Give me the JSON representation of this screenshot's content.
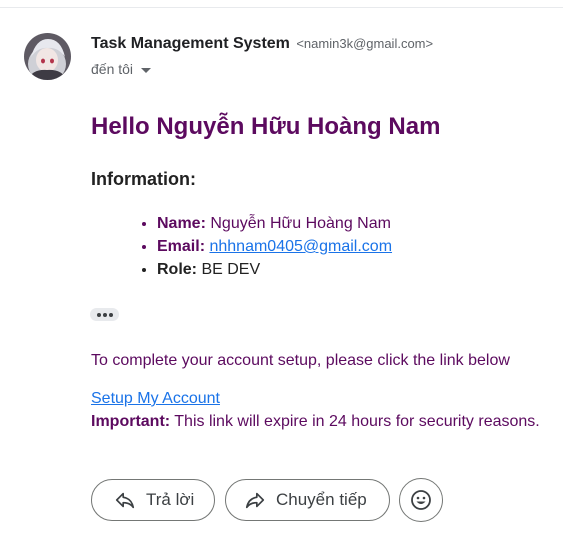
{
  "sender": {
    "name": "Task Management System",
    "email": "<namin3k@gmail.com>",
    "recipient_label": "đến tôi"
  },
  "body": {
    "greeting": "Hello Nguyễn Hữu Hoàng Nam",
    "info_heading": "Information:",
    "info_items": [
      {
        "label": "Name:",
        "value": "Nguyễn Hữu Hoàng Nam"
      },
      {
        "label": "Email:",
        "value": "nhhnam0405@gmail.com"
      },
      {
        "label": "Role:",
        "value": "BE DEV"
      }
    ],
    "complete_text": "To complete your account setup, please click the link below",
    "setup_link": "Setup My Account",
    "important_label": "Important:",
    "important_text": " This link will expire in 24 hours for security reasons."
  },
  "actions": {
    "reply_label": "Trả lời",
    "forward_label": "Chuyển tiếp"
  },
  "icons": {
    "reply": "reply-icon",
    "forward": "forward-icon",
    "emoji": "emoji-icon",
    "more": "more-dots-icon",
    "dropdown": "chevron-down-icon"
  },
  "colors": {
    "heading": "#5c0a5f",
    "link": "#1a73e8",
    "text": "#222222",
    "secondary": "#5f6368"
  }
}
